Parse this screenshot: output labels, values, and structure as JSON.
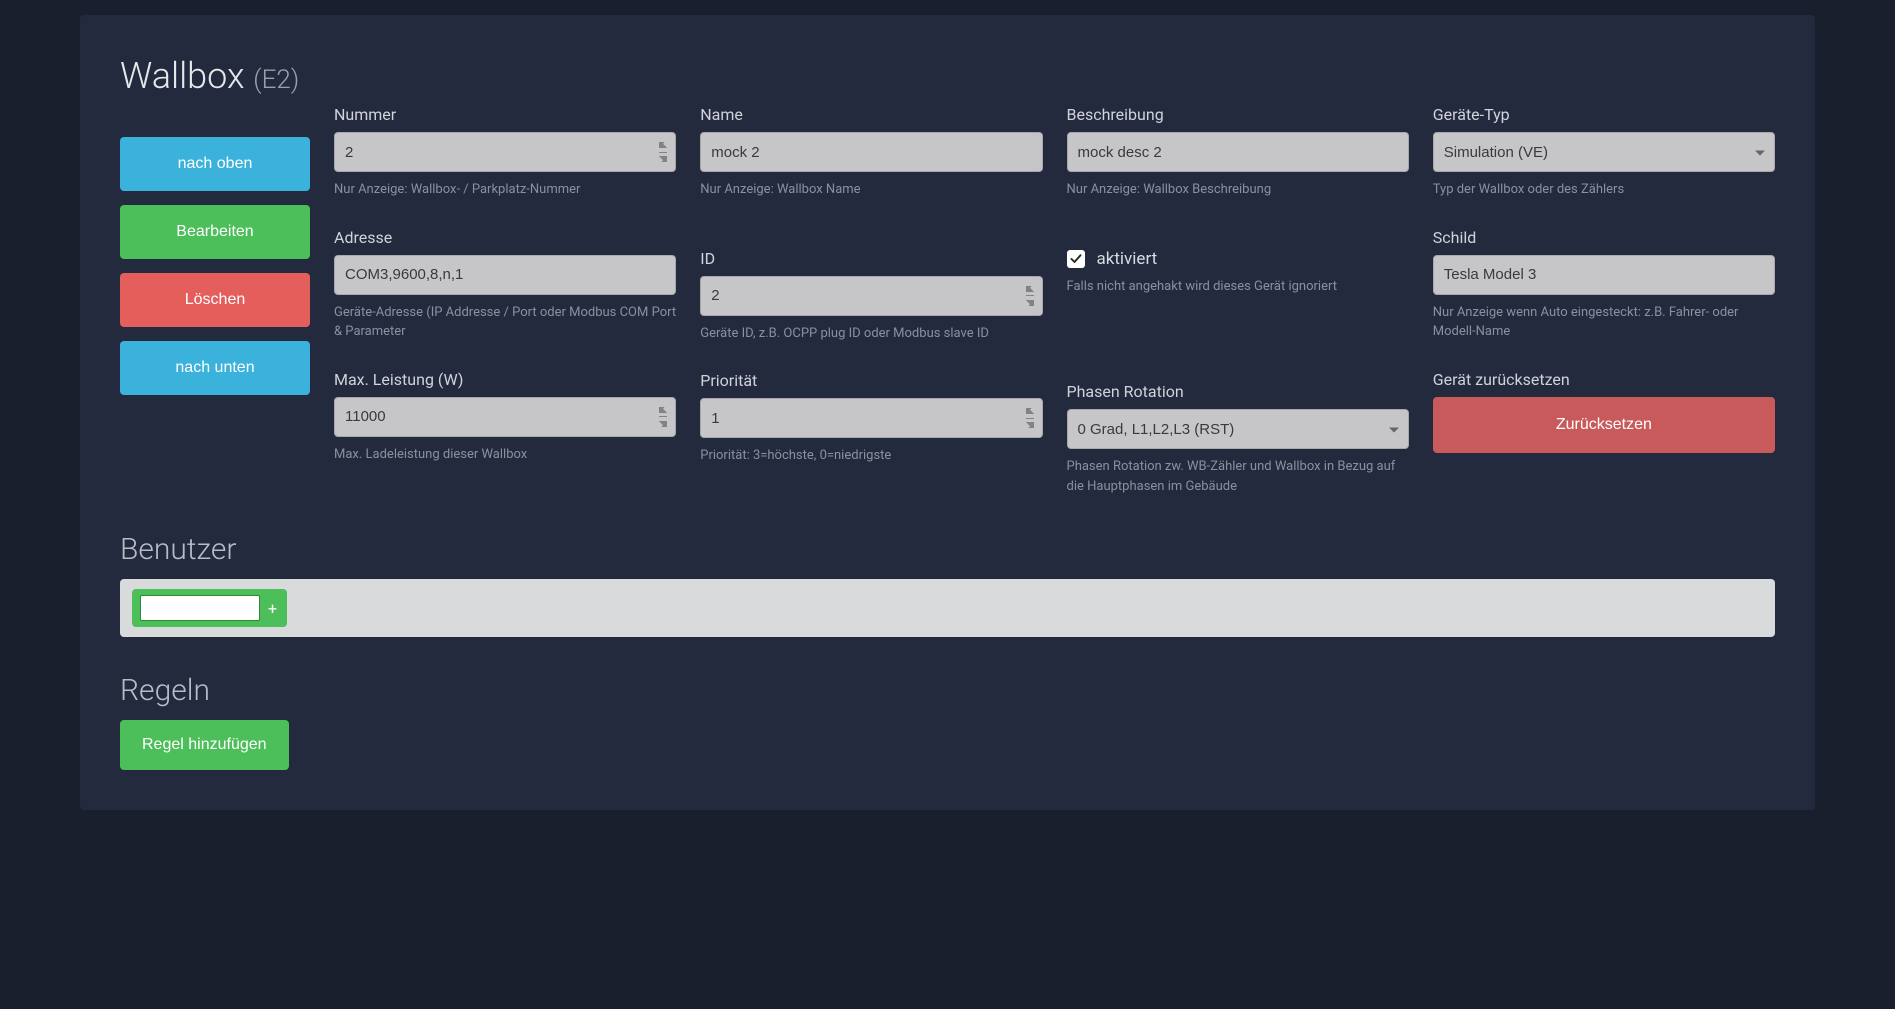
{
  "header": {
    "title": "Wallbox",
    "subtitle": "(E2)"
  },
  "sidebar": {
    "move_up": "nach oben",
    "edit": "Bearbeiten",
    "delete": "Löschen",
    "move_down": "nach unten"
  },
  "fields": {
    "number": {
      "label": "Nummer",
      "value": "2",
      "help": "Nur Anzeige: Wallbox- / Parkplatz-Nummer"
    },
    "name": {
      "label": "Name",
      "value": "mock 2",
      "help": "Nur Anzeige: Wallbox Name"
    },
    "description": {
      "label": "Beschreibung",
      "value": "mock desc 2",
      "help": "Nur Anzeige: Wallbox Beschreibung"
    },
    "device_type": {
      "label": "Geräte-Typ",
      "value": "Simulation (VE)",
      "help": "Typ der Wallbox oder des Zählers"
    },
    "address": {
      "label": "Adresse",
      "value": "COM3,9600,8,n,1",
      "help": "Geräte-Adresse (IP Addresse / Port oder Modbus COM Port & Parameter"
    },
    "id": {
      "label": "ID",
      "value": "2",
      "help": "Geräte ID, z.B. OCPP plug ID oder Modbus slave ID"
    },
    "activated": {
      "label": "aktiviert",
      "checked": true,
      "help": "Falls nicht angehakt wird dieses Gerät ignoriert"
    },
    "label_sign": {
      "label": "Schild",
      "value": "Tesla Model 3",
      "help": "Nur Anzeige wenn Auto eingesteckt: z.B. Fahrer- oder Modell-Name"
    },
    "max_power": {
      "label": "Max. Leistung (W)",
      "value": "11000",
      "help": "Max. Ladeleistung dieser Wallbox"
    },
    "priority": {
      "label": "Priorität",
      "value": "1",
      "help": "Priorität: 3=höchste, 0=niedrigste"
    },
    "phase_rotation": {
      "label": "Phasen Rotation",
      "value": "0 Grad, L1,L2,L3 (RST)",
      "help": "Phasen Rotation zw. WB-Zähler und Wallbox in Bezug auf die Hauptphasen im Gebäude"
    },
    "reset": {
      "label": "Gerät zurücksetzen",
      "button": "Zurücksetzen"
    }
  },
  "users": {
    "title": "Benutzer",
    "add_symbol": "+"
  },
  "rules": {
    "title": "Regeln",
    "add_button": "Regel hinzufügen"
  }
}
